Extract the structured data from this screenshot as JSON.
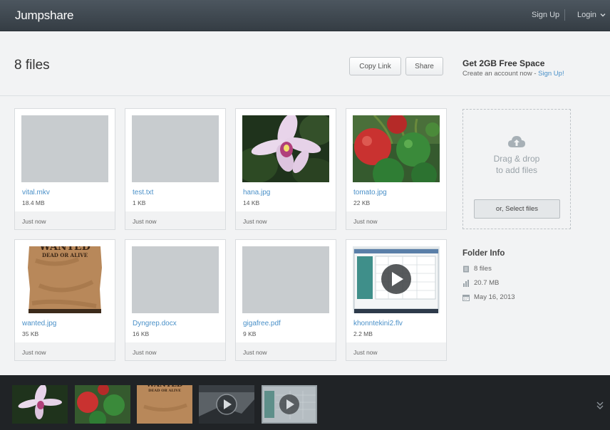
{
  "app": {
    "logo": "Jumpshare"
  },
  "nav": {
    "signup": "Sign Up",
    "login": "Login"
  },
  "header": {
    "title": "8 files",
    "copy_link": "Copy Link",
    "share": "Share"
  },
  "promo": {
    "title": "Get 2GB Free Space",
    "subtitle_prefix": "Create an account now - ",
    "signup_link": "Sign Up!"
  },
  "files": [
    {
      "name": "vital.mkv",
      "size": "18.4 MB",
      "time": "Just now"
    },
    {
      "name": "test.txt",
      "size": "1 KB",
      "time": "Just now"
    },
    {
      "name": "hana.jpg",
      "size": "14 KB",
      "time": "Just now"
    },
    {
      "name": "tomato.jpg",
      "size": "22 KB",
      "time": "Just now"
    },
    {
      "name": "wanted.jpg",
      "size": "35 KB",
      "time": "Just now"
    },
    {
      "name": "Dyngrep.docx",
      "size": "16 KB",
      "time": "Just now"
    },
    {
      "name": "gigafree.pdf",
      "size": "9 KB",
      "time": "Just now"
    },
    {
      "name": "khonntekini2.flv",
      "size": "2.2 MB",
      "time": "Just now"
    }
  ],
  "wanted_poster": {
    "line1": "WANTED",
    "line2": "DEAD OR ALIVE"
  },
  "dropzone": {
    "line1": "Drag & drop",
    "line2": "to add files",
    "button": "or, Select files"
  },
  "folder_info": {
    "title": "Folder Info",
    "count": "8 files",
    "size": "20.7 MB",
    "date": "May 16, 2013"
  },
  "colors": {
    "link": "#4a90c8",
    "topbar": "#3f474e",
    "strip": "#202326"
  }
}
